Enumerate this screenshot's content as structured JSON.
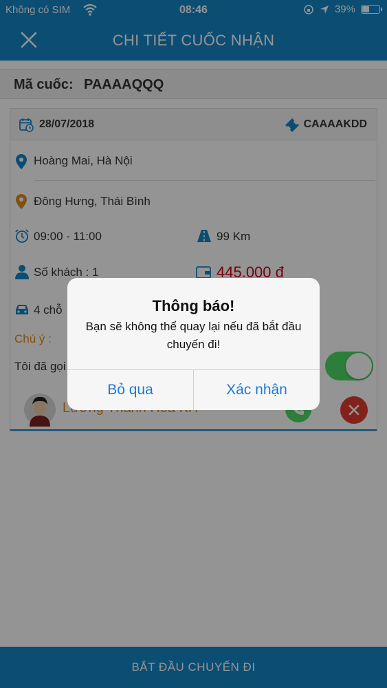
{
  "status_bar": {
    "carrier": "Không có SIM",
    "time": "08:46",
    "battery": "39%"
  },
  "header": {
    "title": "CHI TIẾT CUỐC NHẬN"
  },
  "booking": {
    "code_label": "Mã cuốc:",
    "code_value": "PAAAAQQQ"
  },
  "trip": {
    "date": "28/07/2018",
    "ticket_code": "CAAAAKDD",
    "pickup": "Hoàng Mai, Hà Nội",
    "dropoff": "Đông Hưng, Thái Bình",
    "time_window": "09:00 - 11:00",
    "distance": "99 Km",
    "passengers": "Số khách : 1",
    "price": "445.000 đ",
    "vehicle": "4 chỗ",
    "note_label": "Chú ý :",
    "called_label": "Tôi đã gọi",
    "called_toggle": true
  },
  "driver": {
    "name": "Lương Thanh Hòa KH"
  },
  "footer": {
    "start_button": "BẮT ĐẦU CHUYẾN ĐI"
  },
  "dialog": {
    "title": "Thông báo!",
    "message": "Bạn sẽ không thể quay lại nếu đã bắt đầu chuyến đi!",
    "cancel": "Bỏ qua",
    "confirm": "Xác nhận"
  },
  "colors": {
    "primary": "#1486c6",
    "price": "#d0021b",
    "accent_orange": "#e08a1e",
    "toggle_on": "#4cd964",
    "delete_red": "#e03c31",
    "dialog_button": "#1a7bd6"
  }
}
